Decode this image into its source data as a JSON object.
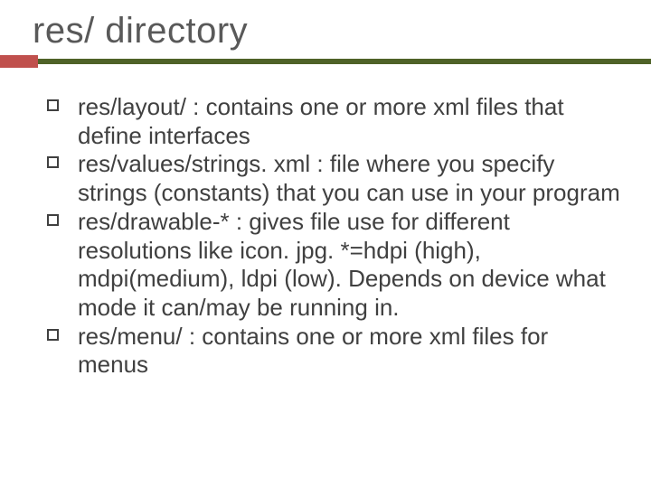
{
  "slide": {
    "title": "res/  directory",
    "bullets": [
      {
        "text": "res/layout/  : contains one or more xml files that define interfaces"
      },
      {
        "text": "res/values/strings. xml :  file where you specify strings (constants) that you can use in your program"
      },
      {
        "text": "res/drawable-*  : gives file use for different resolutions like icon. jpg.   *=hdpi (high), mdpi(medium), ldpi (low).   Depends on device what mode it can/may be running in."
      },
      {
        "text": "res/menu/ :  contains one or more xml files for menus"
      }
    ]
  }
}
